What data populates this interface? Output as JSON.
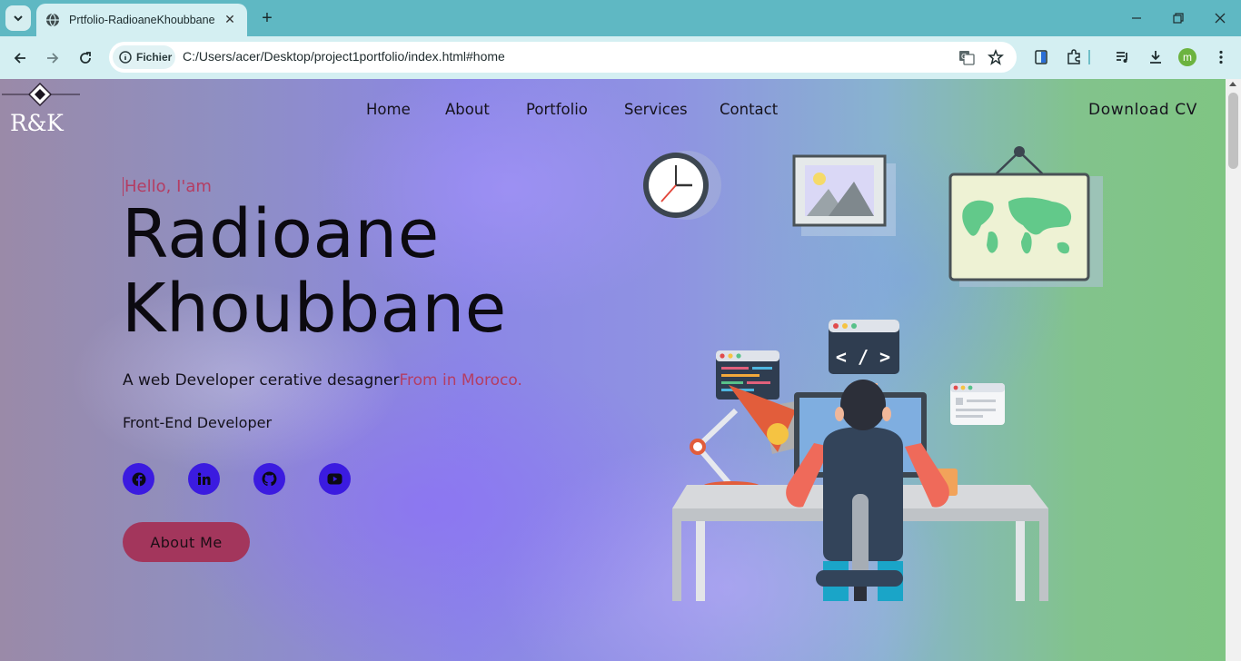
{
  "browser": {
    "tab_title": "Prtfolio-RadioaneKhoubbane",
    "security_chip": "Fichier",
    "url": "C:/Users/acer/Desktop/project1portfolio/index.html#home",
    "profile_initial": "m",
    "profile_color": "#6cb33f"
  },
  "logo": {
    "text": "R&K"
  },
  "nav": {
    "items": [
      "Home",
      "About",
      "Portfolio",
      "Services",
      "Contact"
    ],
    "download_cv": "Download CV"
  },
  "hero": {
    "greeting": "Hello, I'am",
    "name_line1": "Radioane",
    "name_line2": "Khoubbane",
    "tagline_main": "A web Developer cerative desagner",
    "tagline_accent": "From in Moroco.",
    "role": "Front-End Developer",
    "social_icons": [
      "facebook-icon",
      "linkedin-icon",
      "github-icon",
      "youtube-icon"
    ],
    "cta_label": "About Me",
    "code_sign": "< / >"
  },
  "colors": {
    "accent": "#b43d63",
    "social_bg": "#3b1be0",
    "cta_bg": "#a3365c",
    "chrome": "#5fb8c3",
    "toolbar": "#d4eff2"
  }
}
